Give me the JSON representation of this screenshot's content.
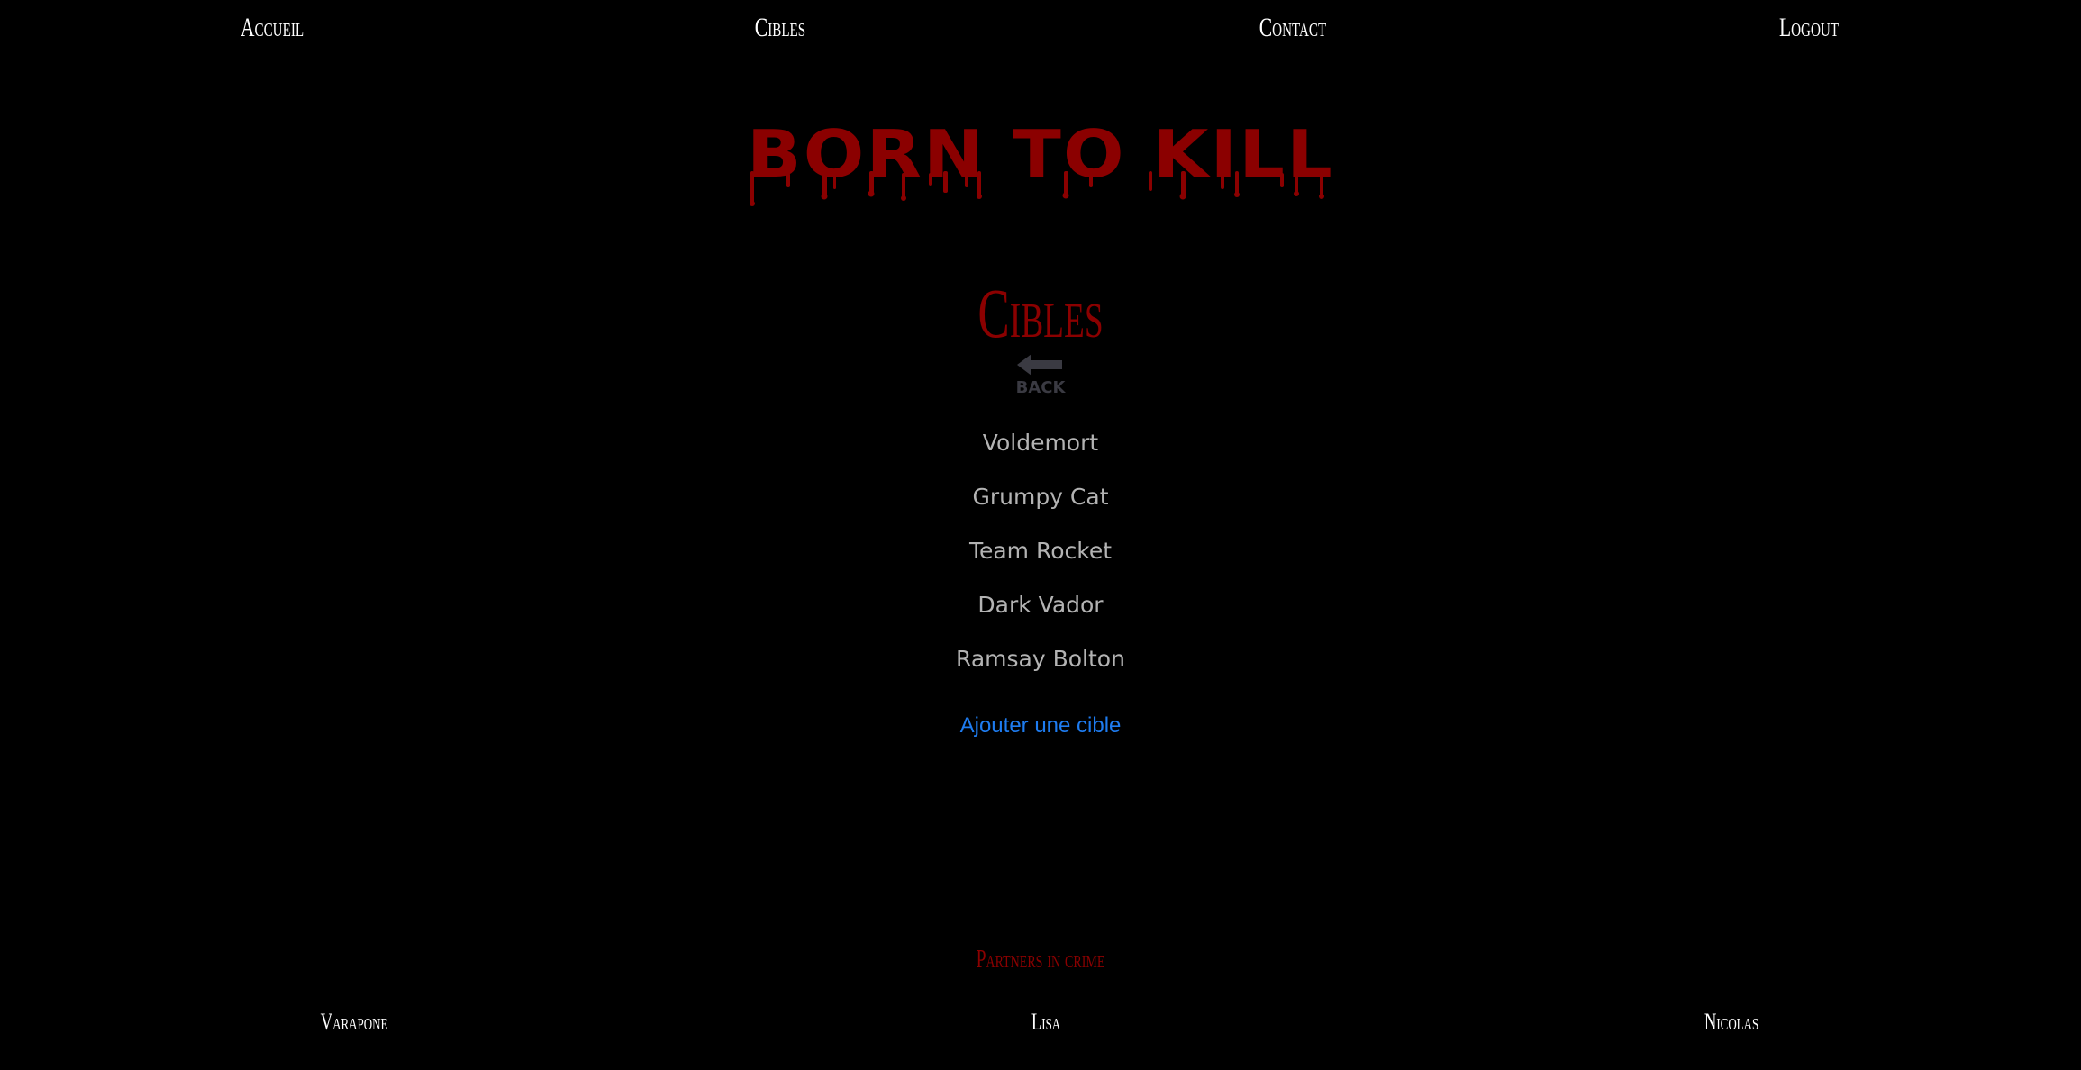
{
  "nav": {
    "items": [
      {
        "label": "Accueil"
      },
      {
        "label": "Cibles"
      },
      {
        "label": "Contact"
      },
      {
        "label": "Logout"
      }
    ]
  },
  "logo": {
    "text": "BORN TO KILL",
    "color": "#8b0000"
  },
  "page": {
    "title": "Cibles",
    "back_label": "BACK",
    "back_icon": "arrow-left-icon"
  },
  "targets": [
    "Voldemort",
    "Grumpy Cat",
    "Team Rocket",
    "Dark Vador",
    "Ramsay Bolton"
  ],
  "add_link": {
    "label": "Ajouter une cible",
    "color": "#1e7cf0"
  },
  "footer": {
    "title": "Partners in crime",
    "partners": [
      "Varapone",
      "Lisa",
      "Nicolas"
    ]
  },
  "colors": {
    "background": "#000000",
    "accent": "#8b0000",
    "text_muted": "#b3b3b3",
    "link": "#1e7cf0"
  }
}
